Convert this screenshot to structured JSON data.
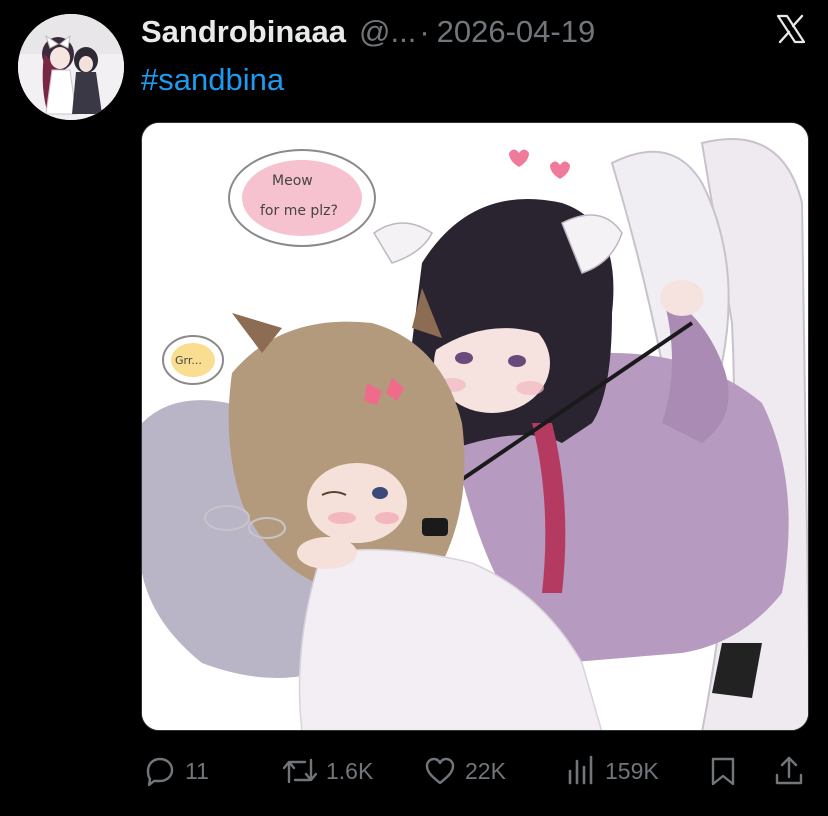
{
  "post": {
    "display_name": "Sandrobinaaa",
    "handle": "@...",
    "separator": "·",
    "date": "2026-04-19",
    "hashtag": "#sandbina"
  },
  "image": {
    "speech_bubble_1_line_1": "Meow",
    "speech_bubble_1_line_2": "for me plz?",
    "speech_bubble_2": "Grr..."
  },
  "actions": {
    "replies": "11",
    "reposts": "1.6K",
    "likes": "22K",
    "views": "159K"
  },
  "icons": {
    "brand": "x-logo-icon",
    "reply": "reply-icon",
    "repost": "repost-icon",
    "like": "heart-icon",
    "views": "views-chart-icon",
    "bookmark": "bookmark-icon",
    "share": "share-icon"
  },
  "colors": {
    "background": "#000000",
    "text_primary": "#e7e9ea",
    "text_secondary": "#71767b",
    "link": "#1d9bf0"
  }
}
